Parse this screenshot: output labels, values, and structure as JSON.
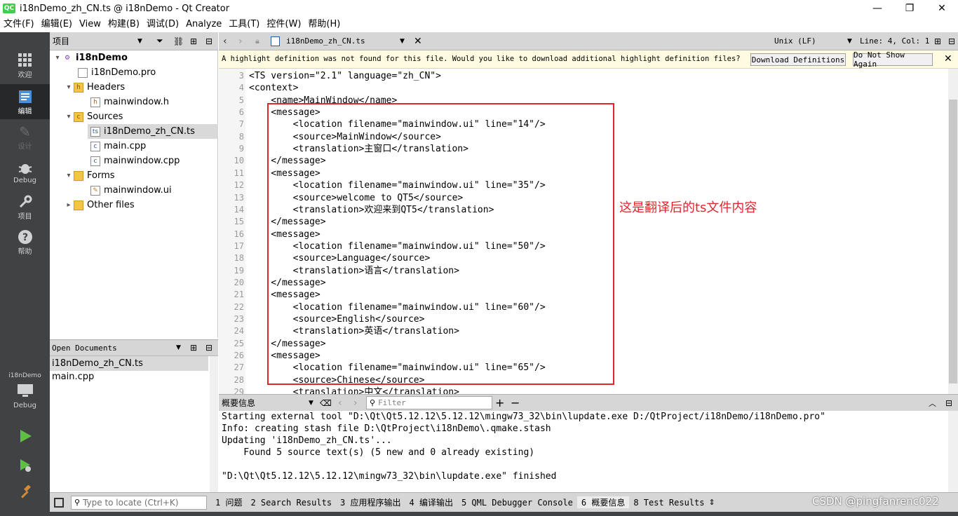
{
  "window": {
    "title": "i18nDemo_zh_CN.ts @ i18nDemo - Qt Creator",
    "logo": "QC",
    "buttons": {
      "minimize": "—",
      "maximize": "❐",
      "close": "✕"
    }
  },
  "menu": [
    "文件(F)",
    "编辑(E)",
    "View",
    "构建(B)",
    "调试(D)",
    "Analyze",
    "工具(T)",
    "控件(W)",
    "帮助(H)"
  ],
  "modes": {
    "welcome": "欢迎",
    "edit": "编辑",
    "design": "设计",
    "debug": "Debug",
    "projects": "项目",
    "help": "帮助",
    "kit_project": "i18nDemo",
    "kit_config": "Debug"
  },
  "project_panel": {
    "header": "项目",
    "tree": [
      {
        "label": "i18nDemo",
        "level": 0,
        "arrow": "▾",
        "icon": "project-icon"
      },
      {
        "label": "i18nDemo.pro",
        "level": 1,
        "arrow": "",
        "icon": "pro-file-icon"
      },
      {
        "label": "Headers",
        "level": 1,
        "arrow": "▾",
        "icon": "folder-icon"
      },
      {
        "label": "mainwindow.h",
        "level": 2,
        "arrow": "",
        "icon": "header-file-icon"
      },
      {
        "label": "Sources",
        "level": 1,
        "arrow": "▾",
        "icon": "folder-icon"
      },
      {
        "label": "i18nDemo_zh_CN.ts",
        "level": 2,
        "arrow": "",
        "icon": "ts-file-icon"
      },
      {
        "label": "main.cpp",
        "level": 2,
        "arrow": "",
        "icon": "cpp-file-icon"
      },
      {
        "label": "mainwindow.cpp",
        "level": 2,
        "arrow": "",
        "icon": "cpp-file-icon"
      },
      {
        "label": "Forms",
        "level": 1,
        "arrow": "▾",
        "icon": "folder-icon"
      },
      {
        "label": "mainwindow.ui",
        "level": 2,
        "arrow": "",
        "icon": "ui-file-icon"
      },
      {
        "label": "Other files",
        "level": 1,
        "arrow": "▸",
        "icon": "folder-icon"
      }
    ]
  },
  "open_documents": {
    "header": "Open Documents",
    "items": [
      "i18nDemo_zh_CN.ts",
      "main.cpp"
    ]
  },
  "editor_toolbar": {
    "file_name": "i18nDemo_zh_CN.ts",
    "line_ending": "Unix (LF)",
    "position": "Line: 4, Col: 1"
  },
  "infobar": {
    "message": "A highlight definition was not found for this file. Would you like to download additional highlight definition files?",
    "download_label": "Download Definitions",
    "dont_show_label": "Do Not Show Again"
  },
  "code": {
    "first_line": 3,
    "lines": [
      "<TS version=\"2.1\" language=\"zh_CN\">",
      "<context>",
      "    <name>MainWindow</name>",
      "    <message>",
      "        <location filename=\"mainwindow.ui\" line=\"14\"/>",
      "        <source>MainWindow</source>",
      "        <translation>主窗口</translation>",
      "    </message>",
      "    <message>",
      "        <location filename=\"mainwindow.ui\" line=\"35\"/>",
      "        <source>welcome to QT5</source>",
      "        <translation>欢迎来到QT5</translation>",
      "    </message>",
      "    <message>",
      "        <location filename=\"mainwindow.ui\" line=\"50\"/>",
      "        <source>Language</source>",
      "        <translation>语言</translation>",
      "    </message>",
      "    <message>",
      "        <location filename=\"mainwindow.ui\" line=\"60\"/>",
      "        <source>English</source>",
      "        <translation>英语</translation>",
      "    </message>",
      "    <message>",
      "        <location filename=\"mainwindow.ui\" line=\"65\"/>",
      "        <source>Chinese</source>",
      "        <translation>中文</translation>"
    ]
  },
  "annotation": "这是翻译后的ts文件内容",
  "output": {
    "title": "概要信息",
    "filter_placeholder": "Filter",
    "lines": [
      "Starting external tool \"D:\\Qt\\Qt5.12.12\\5.12.12\\mingw73_32\\bin\\lupdate.exe D:/QtProject/i18nDemo/i18nDemo.pro\"",
      "Info: creating stash file D:\\QtProject\\i18nDemo\\.qmake.stash",
      "Updating 'i18nDemo_zh_CN.ts'...",
      "    Found 5 source text(s) (5 new and 0 already existing)",
      "",
      "\"D:\\Qt\\Qt5.12.12\\5.12.12\\mingw73_32\\bin\\lupdate.exe\" finished"
    ]
  },
  "statusbar": {
    "locator_placeholder": "Type to locate (Ctrl+K)",
    "panes": [
      "1 问题",
      "2 Search Results",
      "3 应用程序输出",
      "4 编译输出",
      "5 QML Debugger Console",
      "6 概要信息",
      "8 Test Results"
    ]
  },
  "watermark": "CSDN @pingfanrenc022"
}
